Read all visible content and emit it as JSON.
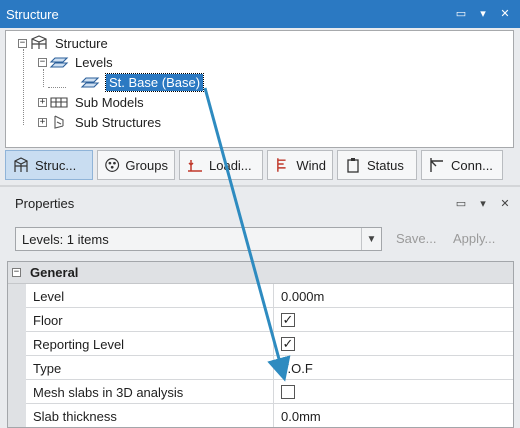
{
  "structure_panel": {
    "title": "Structure",
    "tree": {
      "root_label": "Structure",
      "levels_label": "Levels",
      "selected_label": "St. Base (Base)",
      "sub_models_label": "Sub Models",
      "sub_structures_label": "Sub Structures"
    },
    "tabs": [
      {
        "label": "Struc...",
        "icon": "structure-icon"
      },
      {
        "label": "Groups",
        "icon": "groups-icon"
      },
      {
        "label": "Loadi...",
        "icon": "loading-icon"
      },
      {
        "label": "Wind",
        "icon": "wind-icon"
      },
      {
        "label": "Status",
        "icon": "status-icon"
      },
      {
        "label": "Conn...",
        "icon": "connections-icon"
      }
    ]
  },
  "properties_panel": {
    "title": "Properties",
    "filter": {
      "selected": "Levels: 1 items",
      "save_label": "Save...",
      "apply_label": "Apply..."
    },
    "category": {
      "expander": "⊟",
      "label": "General"
    },
    "rows": [
      {
        "name": "Level",
        "value": "0.000m"
      },
      {
        "name": "Floor",
        "checked": true
      },
      {
        "name": "Reporting Level",
        "checked": true
      },
      {
        "name": "Type",
        "value": "T.O.F"
      },
      {
        "name": "Mesh slabs in 3D analysis",
        "checked": false
      },
      {
        "name": "Slab thickness",
        "value": "0.0mm"
      }
    ]
  },
  "colors": {
    "accent": "#2b79c2",
    "annotation_arrow": "#2e8bc0"
  }
}
